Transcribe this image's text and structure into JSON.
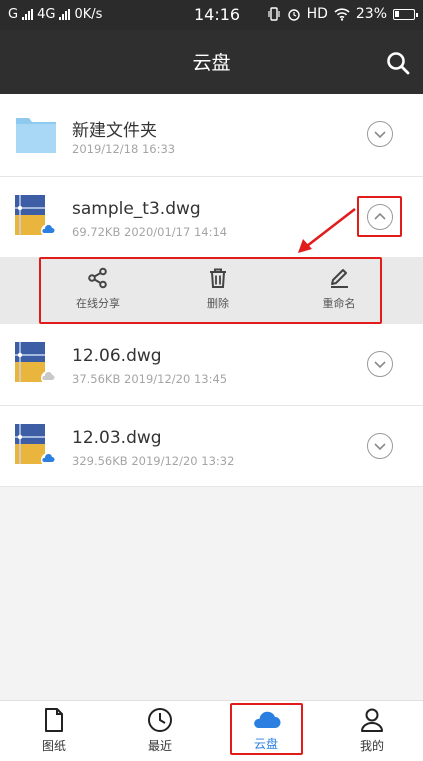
{
  "status_bar": {
    "left_text_1": "G",
    "left_text_2": "4G",
    "speed": "0K/s",
    "time": "14:16",
    "hd": "HD",
    "battery": "23%",
    "battery_level": 0.23
  },
  "header": {
    "title": "云盘"
  },
  "files": [
    {
      "name": "新建文件夹",
      "meta": "2019/12/18 16:33",
      "type": "folder",
      "cloud": "none"
    },
    {
      "name": "sample_t3.dwg",
      "meta": "69.72KB  2020/01/17 14:14",
      "type": "dwg",
      "cloud": "synced",
      "expanded": true
    },
    {
      "name": "12.06.dwg",
      "meta": "37.56KB  2019/12/20 13:45",
      "type": "dwg",
      "cloud": "gray"
    },
    {
      "name": "12.03.dwg",
      "meta": "329.56KB  2019/12/20 13:32",
      "type": "dwg",
      "cloud": "synced"
    }
  ],
  "actions": [
    {
      "label": "在线分享",
      "icon": "share-icon"
    },
    {
      "label": "删除",
      "icon": "trash-icon"
    },
    {
      "label": "重命名",
      "icon": "pencil-icon"
    }
  ],
  "tabs": [
    {
      "label": "图纸",
      "icon": "document-icon",
      "active": false
    },
    {
      "label": "最近",
      "icon": "clock-icon",
      "active": false
    },
    {
      "label": "云盘",
      "icon": "cloud-icon",
      "active": true
    },
    {
      "label": "我的",
      "icon": "person-icon",
      "active": false
    }
  ],
  "colors": {
    "annotation": "#e21b1b",
    "active_tab": "#2a7fe0",
    "header_bg": "#2f2f2f"
  }
}
